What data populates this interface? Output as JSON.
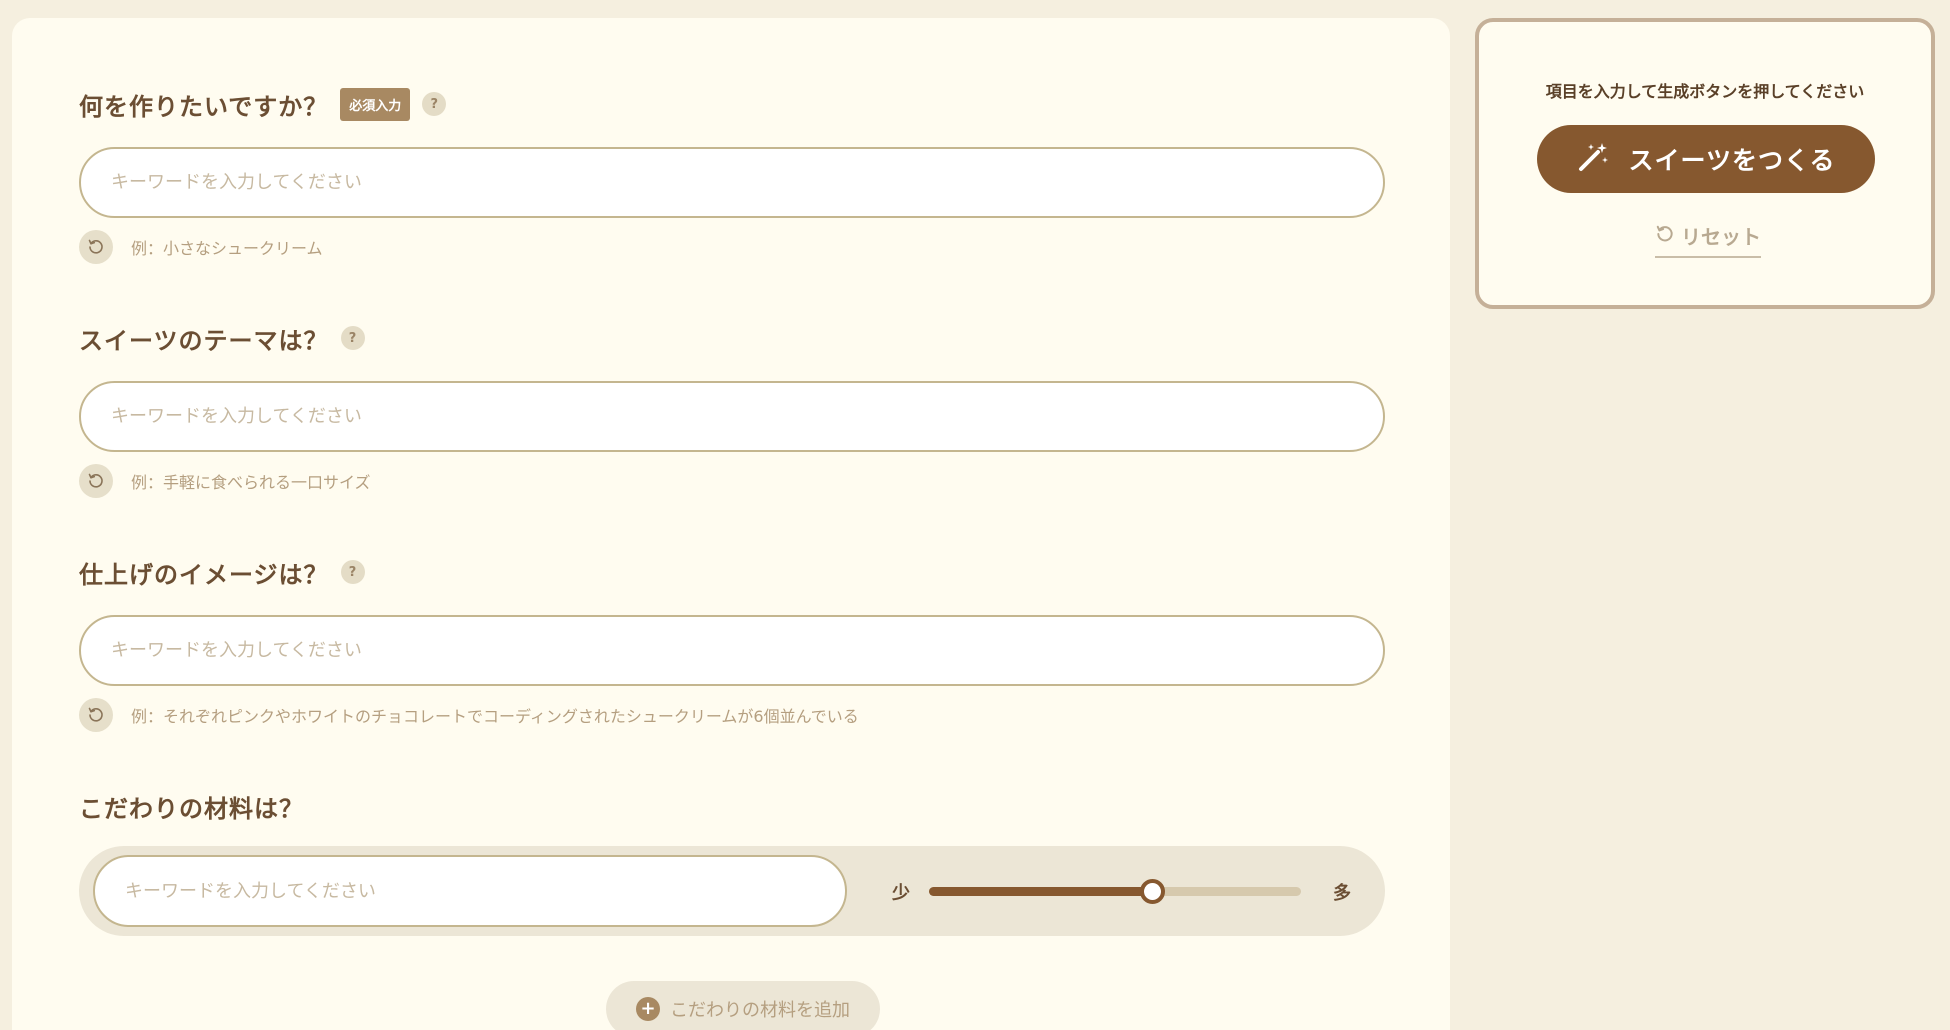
{
  "form": {
    "q1": {
      "title": "何を作りたいですか？",
      "badge": "必須入力",
      "placeholder": "キーワードを入力してください",
      "example": "例：小さなシュークリーム"
    },
    "q2": {
      "title": "スイーツのテーマは？",
      "placeholder": "キーワードを入力してください",
      "example": "例：手軽に食べられる一口サイズ"
    },
    "q3": {
      "title": "仕上げのイメージは？",
      "placeholder": "キーワードを入力してください",
      "example": "例：それぞれピンクやホワイトのチョコレートでコーディングされたシュークリームが6個並んでいる"
    },
    "q4": {
      "title": "こだわりの材料は？",
      "placeholder": "キーワードを入力してください",
      "amount_min_label": "少",
      "amount_max_label": "多",
      "amount_level": 0.6
    },
    "add_ingredient_label": "こだわりの材料を追加",
    "help_mark": "?",
    "add_mark": "+"
  },
  "side": {
    "hint": "項目を入力して生成ボタンを押してください",
    "generate_label": "スイーツをつくる",
    "reset_label": "リセット"
  },
  "colors": {
    "background": "#f5efdf",
    "panel": "#fffcf0",
    "accent": "#86582f",
    "badge": "#a88962",
    "input_border": "#c4b68f"
  },
  "icons": {
    "help": "question-circle-icon",
    "refresh": "refresh-icon",
    "wand": "magic-wand-icon",
    "reset": "reset-icon",
    "add": "plus-circle-icon"
  }
}
